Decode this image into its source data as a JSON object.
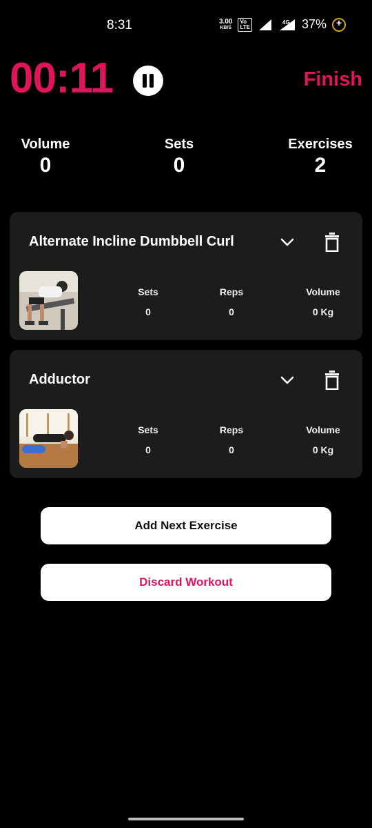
{
  "status_bar": {
    "time": "8:31",
    "speed_value": "3.00",
    "speed_unit": "KB/S",
    "volte": "VoLTE 2",
    "network": "4G",
    "battery": "37%"
  },
  "timer": {
    "elapsed": "00:11",
    "finish_label": "Finish"
  },
  "summary": {
    "volume_label": "Volume",
    "volume_value": "0",
    "sets_label": "Sets",
    "sets_value": "0",
    "exercises_label": "Exercises",
    "exercises_value": "2"
  },
  "exercises": [
    {
      "name": "Alternate Incline Dumbbell Curl",
      "sets_label": "Sets",
      "sets": "0",
      "reps_label": "Reps",
      "reps": "0",
      "volume_label": "Volume",
      "volume": "0 Kg"
    },
    {
      "name": "Adductor",
      "sets_label": "Sets",
      "sets": "0",
      "reps_label": "Reps",
      "reps": "0",
      "volume_label": "Volume",
      "volume": "0 Kg"
    }
  ],
  "actions": {
    "add_next": "Add Next Exercise",
    "discard": "Discard Workout"
  },
  "colors": {
    "accent": "#e0135f",
    "card_bg": "#1c1c1c",
    "background": "#000000"
  }
}
